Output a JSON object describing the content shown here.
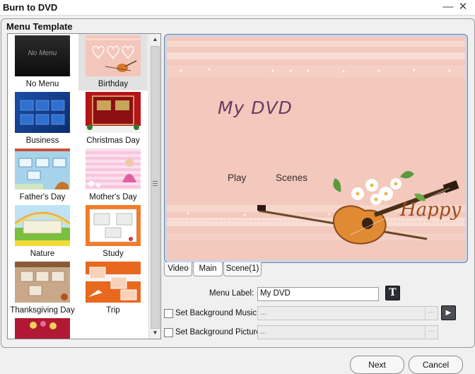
{
  "window": {
    "title": "Burn to DVD",
    "minimize_glyph": "—",
    "close_glyph": "✕"
  },
  "menu_template": {
    "title": "Menu Template",
    "items": [
      {
        "label": "No Menu",
        "thumb_text": "No Menu",
        "selected": false
      },
      {
        "label": "Birthday",
        "selected": true
      },
      {
        "label": "Business",
        "selected": false
      },
      {
        "label": "Christmas Day",
        "selected": false
      },
      {
        "label": "Father's Day",
        "selected": false
      },
      {
        "label": "Mother's Day",
        "selected": false
      },
      {
        "label": "Nature",
        "selected": false
      },
      {
        "label": "Study",
        "selected": false
      },
      {
        "label": "Thanksgiving Day",
        "selected": false
      },
      {
        "label": "Trip",
        "selected": false
      }
    ]
  },
  "preview": {
    "title": "My DVD",
    "play": "Play",
    "scenes": "Scenes",
    "happy": "Happy"
  },
  "tabs": [
    {
      "label": "Video",
      "active": false
    },
    {
      "label": "Main",
      "active": true
    },
    {
      "label": "Scene(1)",
      "active": false
    }
  ],
  "form": {
    "menu_label_text": "Menu Label:",
    "menu_label_value": "My DVD",
    "text_button": "T",
    "bg_music_label": "Set Background Music",
    "bg_music_value": "...",
    "bg_music_checked": false,
    "bg_picture_label": "Set Background Picture",
    "bg_picture_value": "...",
    "bg_picture_checked": false,
    "browse_glyph": "···",
    "play_glyph": "▶"
  },
  "buttons": {
    "next": "Next",
    "cancel": "Cancel"
  },
  "colors": {
    "preview_bg": "#f3c9bd",
    "title_text": "#6b3a5e",
    "happy_text": "#9a4a1c"
  }
}
